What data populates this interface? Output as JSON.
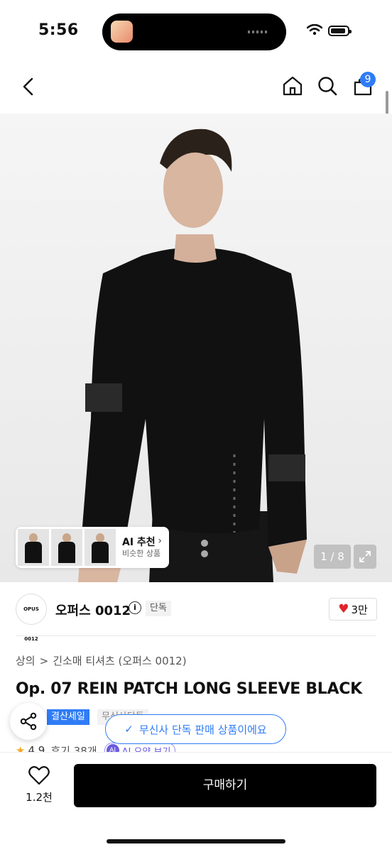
{
  "status_bar": {
    "time": "5:56"
  },
  "header": {
    "cart_count": "9"
  },
  "gallery": {
    "ai_title": "AI 추천",
    "ai_subtitle": "비슷한 상품",
    "counter": "1 / 8"
  },
  "brand": {
    "logo_text": "OPUS 0012",
    "name": "오퍼스 0012",
    "info_glyph": "i",
    "tag": "단독",
    "likes": "3만"
  },
  "breadcrumb": [
    "상의",
    "긴소매 티셔츠 (오퍼스 0012)"
  ],
  "breadcrumb_sep": ">",
  "product": {
    "title": "Op. 07 REIN PATCH LONG SLEEVE BLACK",
    "sale_badge": "결산세일",
    "muted_tag": "무신사단독",
    "rating": "4.9",
    "reviews": "후기 38개",
    "ai_summary_icon": "AI",
    "ai_summary": "AI 요약 보기"
  },
  "toast": {
    "text": "무신사 단독 판매 상품이에요"
  },
  "bottom_bar": {
    "wish_count": "1.2천",
    "buy_label": "구매하기"
  },
  "colors": {
    "accent": "#2f7cf6",
    "heart": "#e0242b",
    "buy_button": "#000000"
  },
  "icons": [
    "back-icon",
    "home-icon",
    "search-icon",
    "cart-icon",
    "expand-icon",
    "share-icon",
    "heart-icon",
    "star-icon",
    "check-icon"
  ]
}
